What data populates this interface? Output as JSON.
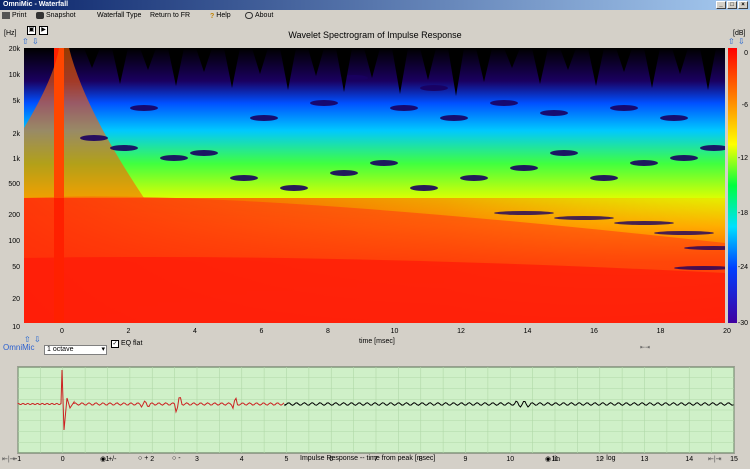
{
  "window": {
    "title": "OmniMic - Waterfall"
  },
  "menu": {
    "print": "Print",
    "snapshot": "Snapshot",
    "waterfall_type": "Waterfall Type",
    "return": "Return to FR",
    "help": "Help",
    "about": "About"
  },
  "spectrogram": {
    "title": "Wavelet Spectrogram of Impulse Response",
    "y_unit": "[Hz]",
    "y_ticks": [
      "20k",
      "10k",
      "5k",
      "2k",
      "1k",
      "500",
      "200",
      "100",
      "50",
      "20",
      "10"
    ],
    "x_ticks": [
      "0",
      "2",
      "4",
      "6",
      "8",
      "10",
      "12",
      "14",
      "16",
      "18",
      "20"
    ],
    "x_label": "time [msec]",
    "cbar_unit": "[dB]",
    "cbar_ticks": [
      "0",
      "-6",
      "-12",
      "-18",
      "-24",
      "-30"
    ],
    "smoothing": "1 octave",
    "eq_flat": "EQ flat",
    "brand": "OmniMic"
  },
  "impulse": {
    "x_ticks": [
      "-1",
      "0",
      "1",
      "2",
      "3",
      "4",
      "5",
      "6",
      "7",
      "8",
      "9",
      "10",
      "11",
      "12",
      "13",
      "14",
      "15"
    ],
    "x_label": "Impulse Response  -- time from peak [msec]",
    "polarity": {
      "plusminus": "+/-",
      "plus": "+",
      "minus": "-"
    },
    "scale": {
      "lin": "lin",
      "log": "log"
    },
    "colors": {
      "bg": "#cff0c8",
      "trace_early": "#cc2222",
      "trace_late": "#000000"
    }
  },
  "colors": {
    "accent": "#0a246a"
  }
}
